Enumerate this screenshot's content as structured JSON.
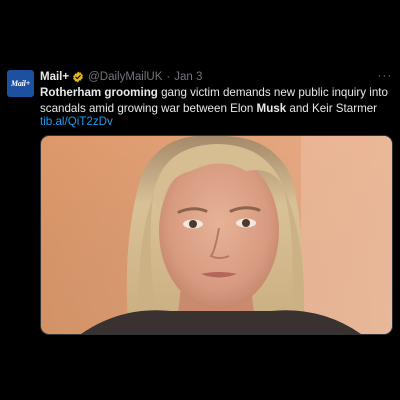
{
  "tweet": {
    "avatar_text": "Mail+",
    "display_name": "Mail+",
    "handle": "@DailyMailUK",
    "separator": "·",
    "date": "Jan 3",
    "more_label": "···",
    "text": {
      "part1": "Rotherham grooming",
      "part2": " gang victim demands new public inquiry into scandals amid growing war between Elon ",
      "part3": "Musk",
      "part4": " and Keir Starmer"
    },
    "link": "tib.al/QiT2zDv",
    "media_icon": "photo-of-woman"
  },
  "colors": {
    "background": "#000000",
    "text": "#e7e9ea",
    "muted": "#71767b",
    "link": "#1d9bf0",
    "verified": "#e2b719",
    "avatar": "#1e50a2"
  }
}
